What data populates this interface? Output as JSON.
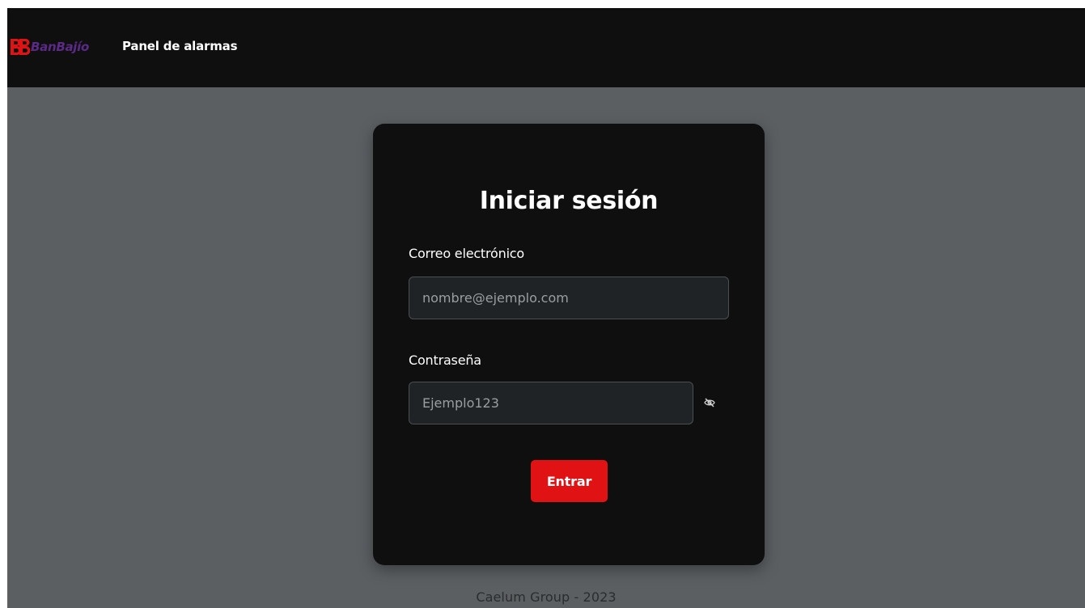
{
  "navbar": {
    "brand_name": "BanBajío",
    "title": "Panel de alarmas"
  },
  "login": {
    "title": "Iniciar sesión",
    "email": {
      "label": "Correo electrónico",
      "value": "",
      "placeholder": "nombre@ejemplo.com"
    },
    "password": {
      "label": "Contraseña",
      "value": "",
      "placeholder": "Ejemplo123",
      "toggle_icon": "eye-slash-icon"
    },
    "submit_label": "Entrar"
  },
  "footer": {
    "text": "Caelum Group - 2023"
  },
  "colors": {
    "page_background": "#5b5f62",
    "navbar_background": "#0f0f10",
    "card_background": "#0f0f10",
    "input_background": "#202326",
    "brand_logo": "#e11214",
    "brand_text": "#5b2a86",
    "primary_button": "#e11214"
  }
}
